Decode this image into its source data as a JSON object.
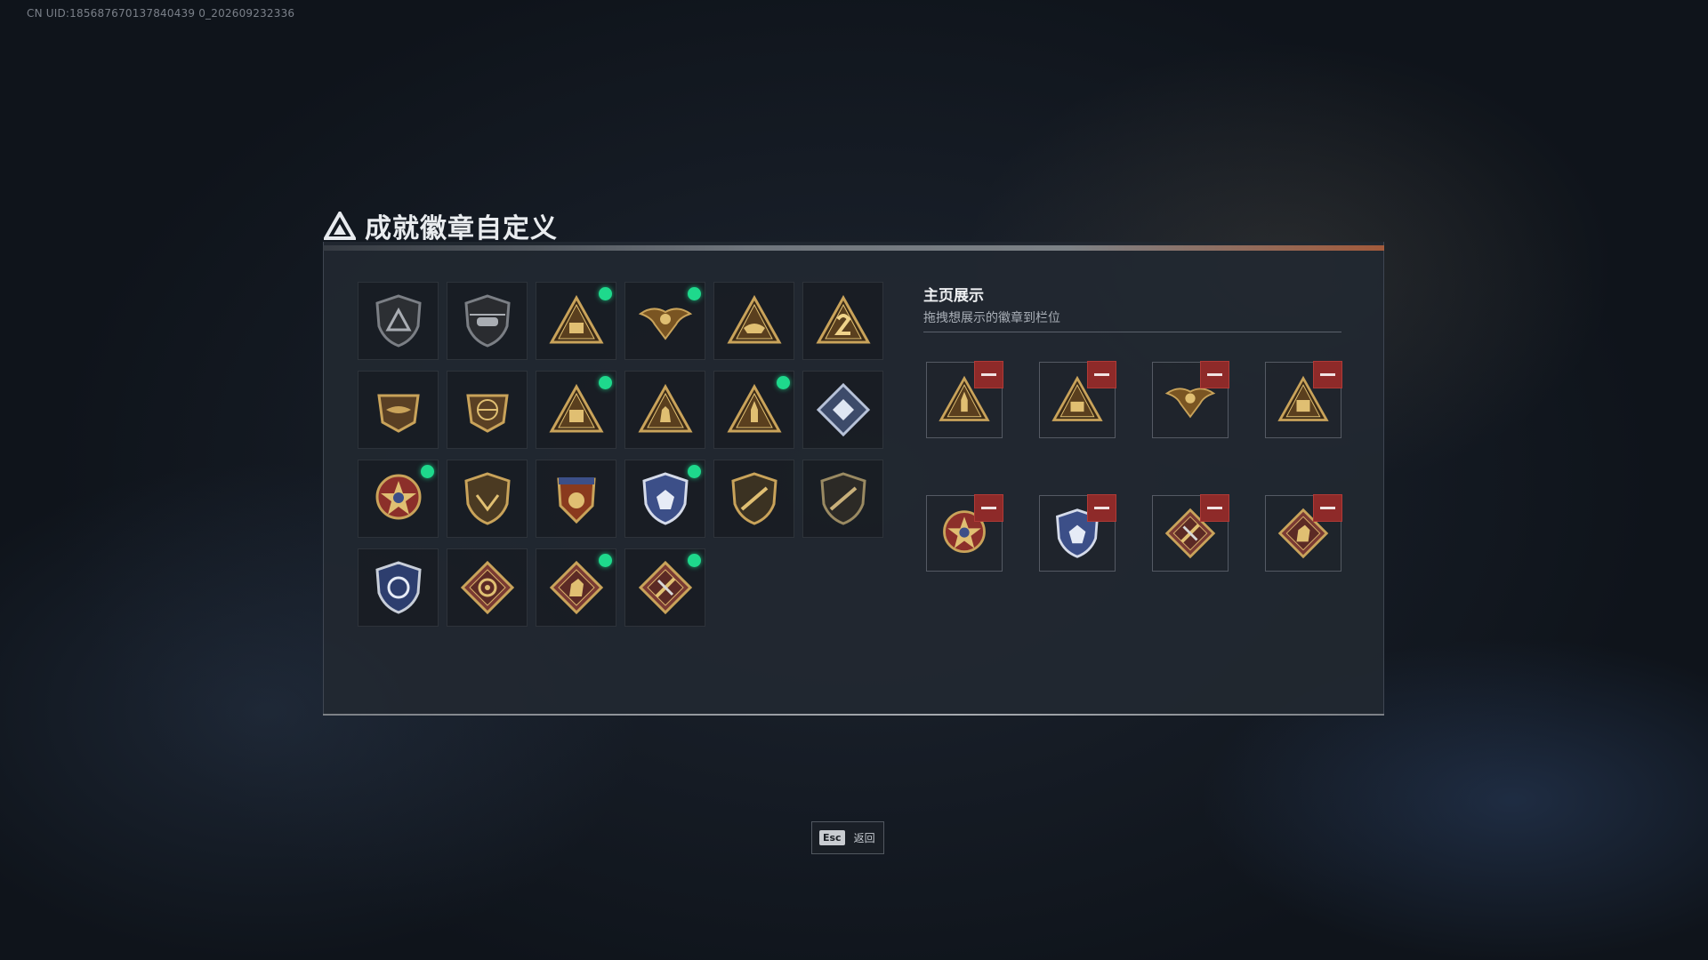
{
  "uid_text": "CN UID:185687670137840439 0_202609232336",
  "header": {
    "title": "成就徽章自定义",
    "logo_icon": "triangle-logo-icon"
  },
  "badges": [
    {
      "icon": "shield-triangle-badge-icon",
      "new": false
    },
    {
      "icon": "helicopter-badge-icon",
      "new": false
    },
    {
      "icon": "triangle-sb-badge-icon",
      "new": true
    },
    {
      "icon": "eagle-badge-icon",
      "new": true
    },
    {
      "icon": "triangle-boat-badge-icon",
      "new": false
    },
    {
      "icon": "triangle-number-2-badge-icon",
      "new": false
    },
    {
      "icon": "crocodile-emblem-badge-icon",
      "new": false
    },
    {
      "icon": "globe-emblem-badge-icon",
      "new": false
    },
    {
      "icon": "triangle-supply-badge-icon",
      "new": true
    },
    {
      "icon": "triangle-soldier-badge-icon",
      "new": false
    },
    {
      "icon": "triangle-rocket-badge-icon",
      "new": true
    },
    {
      "icon": "diamond-crystal-badge-icon",
      "new": false
    },
    {
      "icon": "star-medal-badge-icon",
      "new": true
    },
    {
      "icon": "shield-eagle-badge-icon",
      "new": false
    },
    {
      "icon": "crest-medal-badge-icon",
      "new": false
    },
    {
      "icon": "blue-shield-badge-icon",
      "new": true
    },
    {
      "icon": "shield-rifle-badge-icon",
      "new": false
    },
    {
      "icon": "shield-rifle-dark-badge-icon",
      "new": false
    },
    {
      "icon": "blue-shield-swirl-badge-icon",
      "new": false
    },
    {
      "icon": "diamond-wheel-badge-icon",
      "new": false
    },
    {
      "icon": "diamond-horse-badge-icon",
      "new": true
    },
    {
      "icon": "diamond-tools-badge-icon",
      "new": true
    }
  ],
  "display": {
    "heading": "主页展示",
    "subheading": "拖拽想展示的徽章到栏位",
    "slots": [
      {
        "icon": "triangle-rocket-badge-icon"
      },
      {
        "icon": "triangle-sb-badge-icon"
      },
      {
        "icon": "eagle-badge-icon"
      },
      {
        "icon": "triangle-supply-badge-icon"
      },
      {
        "icon": "star-medal-badge-icon"
      },
      {
        "icon": "blue-shield-badge-icon"
      },
      {
        "icon": "diamond-tools-badge-icon"
      },
      {
        "icon": "diamond-horse-badge-icon"
      }
    ]
  },
  "footer": {
    "esc_key": "Esc",
    "back_label": "返回"
  },
  "colors": {
    "accent_new_dot": "#1ed98c",
    "remove_button": "#8e2a29",
    "badge_gold": "#c9a35a",
    "badge_blue": "#3c4f88",
    "badge_red": "#7a3a33"
  }
}
